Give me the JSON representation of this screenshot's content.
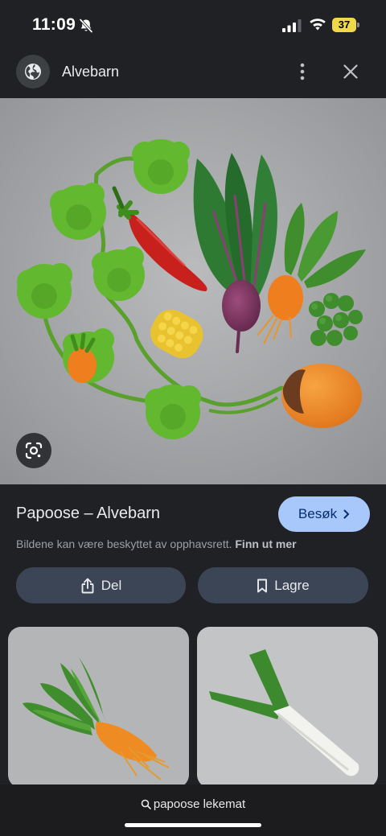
{
  "status_bar": {
    "time": "11:09",
    "battery_level": "37",
    "icons": [
      "bell-slash-icon",
      "cellular-signal-icon",
      "wifi-icon",
      "battery-icon"
    ]
  },
  "header": {
    "site_name": "Alvebarn",
    "icons": [
      "globe-icon",
      "more-vertical-icon",
      "close-icon"
    ]
  },
  "hero_image": {
    "icon": "google-lens-icon"
  },
  "result": {
    "title": "Papoose – Alvebarn",
    "visit_label": "Besøk",
    "copyright_text": "Bildene kan være beskyttet av opphavsrett.",
    "learn_more": "Finn ut mer"
  },
  "actions": {
    "share_label": "Del",
    "save_label": "Lagre"
  },
  "search": {
    "query": "papoose lekemat"
  },
  "colors": {
    "background": "#202124",
    "accent_button": "#a8c7fa",
    "action_button": "#3c4555"
  }
}
